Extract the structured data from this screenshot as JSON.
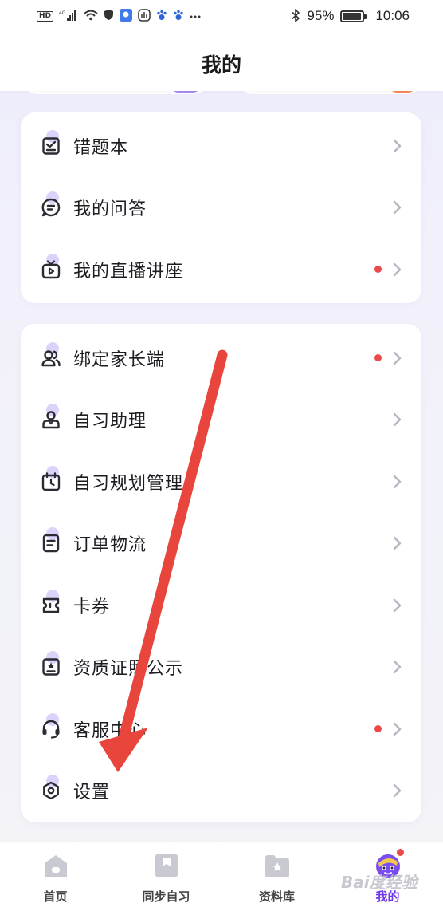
{
  "status_bar": {
    "left_icons": [
      "hd-icon",
      "signal-4g-icon",
      "wifi-icon",
      "shield-icon",
      "app-icon",
      "hand-icon",
      "paw-icon",
      "paw-icon",
      "more-icon"
    ],
    "hd_label": "HD",
    "bluetooth": "bluetooth-icon",
    "battery_percent": "95%",
    "time": "10:06"
  },
  "header": {
    "title": "我的"
  },
  "groups": [
    {
      "items": [
        {
          "label": "错题本",
          "icon": "notebook-check-icon",
          "badge": false
        },
        {
          "label": "我的问答",
          "icon": "chat-bubble-icon",
          "badge": false
        },
        {
          "label": "我的直播讲座",
          "icon": "tv-play-icon",
          "badge": true
        }
      ]
    },
    {
      "items": [
        {
          "label": "绑定家长端",
          "icon": "users-icon",
          "badge": true
        },
        {
          "label": "自习助理",
          "icon": "assistant-icon",
          "badge": false
        },
        {
          "label": "自习规划管理",
          "icon": "calendar-clock-icon",
          "badge": false
        },
        {
          "label": "订单物流",
          "icon": "order-list-icon",
          "badge": false
        },
        {
          "label": "卡券",
          "icon": "ticket-icon",
          "badge": false
        },
        {
          "label": "资质证照公示",
          "icon": "certificate-icon",
          "badge": false
        },
        {
          "label": "客服中心",
          "icon": "headset-icon",
          "badge": true
        },
        {
          "label": "设置",
          "icon": "settings-icon",
          "badge": false
        }
      ]
    }
  ],
  "bottom_nav": [
    {
      "label": "首页",
      "icon": "home-icon",
      "active": false
    },
    {
      "label": "同步自习",
      "icon": "book-icon",
      "active": false
    },
    {
      "label": "资料库",
      "icon": "folder-star-icon",
      "active": false
    },
    {
      "label": "我的",
      "icon": "avatar-icon",
      "active": true
    }
  ],
  "colors": {
    "accent": "#6d3ae6",
    "badge_red": "#ec4a4a",
    "annotation_arrow": "#e8453c",
    "icon_blob": "#d9cdfa"
  },
  "watermark": "Bai度经验"
}
